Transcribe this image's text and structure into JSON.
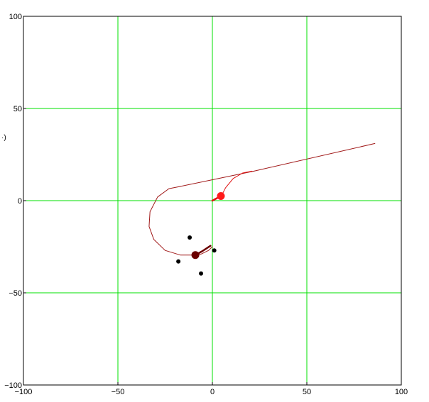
{
  "chart_data": {
    "type": "scatter",
    "title": "",
    "xlabel": "",
    "ylabel": "·)",
    "xlim": [
      -100,
      100
    ],
    "ylim": [
      -100,
      100
    ],
    "x_ticks": [
      -100,
      -50,
      0,
      50,
      100
    ],
    "y_ticks": [
      -100,
      -50,
      0,
      50,
      100
    ],
    "x_tick_labels": [
      "−100",
      "−50",
      "0",
      "50",
      "100"
    ],
    "y_tick_labels": [
      "−100",
      "−50",
      "0",
      "50",
      "100"
    ],
    "grid": true,
    "colors": {
      "grid": "#00e000",
      "frame": "#000000",
      "dark_red_path": "#a01818",
      "red_path": "#e01010",
      "red_marker": "#ff1a1a",
      "dark_marker": "#6b0000",
      "points": "#000000"
    },
    "series": [
      {
        "kind": "line",
        "color_key": "dark_red_path",
        "width": 1,
        "points": [
          [
            86,
            31
          ],
          [
            22,
            16
          ],
          [
            -18,
            7.5
          ],
          [
            -23,
            6.5
          ],
          [
            -29,
            2
          ],
          [
            -33,
            -6
          ],
          [
            -33.5,
            -14
          ],
          [
            -31,
            -21
          ],
          [
            -25,
            -27
          ],
          [
            -17,
            -29.5
          ],
          [
            -10,
            -29.5
          ],
          [
            -6,
            -29
          ],
          [
            -2,
            -27
          ],
          [
            0,
            -25
          ]
        ]
      },
      {
        "kind": "line",
        "color_key": "red_path",
        "width": 1,
        "points": [
          [
            21,
            16
          ],
          [
            16,
            15
          ],
          [
            11,
            12
          ],
          [
            7,
            7
          ],
          [
            5,
            3
          ],
          [
            4.5,
            2.5
          ]
        ]
      },
      {
        "kind": "line",
        "color_key": "red_path",
        "width": 2.5,
        "points": [
          [
            0,
            0
          ],
          [
            4.5,
            2.5
          ]
        ]
      },
      {
        "kind": "line",
        "color_key": "dark_marker",
        "width": 2.5,
        "points": [
          [
            -9,
            -29.5
          ],
          [
            -5.5,
            -27.5
          ],
          [
            -1,
            -24.5
          ]
        ]
      }
    ],
    "markers": [
      {
        "x": 4.5,
        "y": 2.5,
        "color_key": "red_marker",
        "size": "large"
      },
      {
        "x": -9,
        "y": -29.5,
        "color_key": "dark_marker",
        "size": "large"
      }
    ],
    "points": [
      {
        "x": -12,
        "y": -20
      },
      {
        "x": 1,
        "y": -27
      },
      {
        "x": -18,
        "y": -33
      },
      {
        "x": -6,
        "y": -39.5
      }
    ]
  }
}
